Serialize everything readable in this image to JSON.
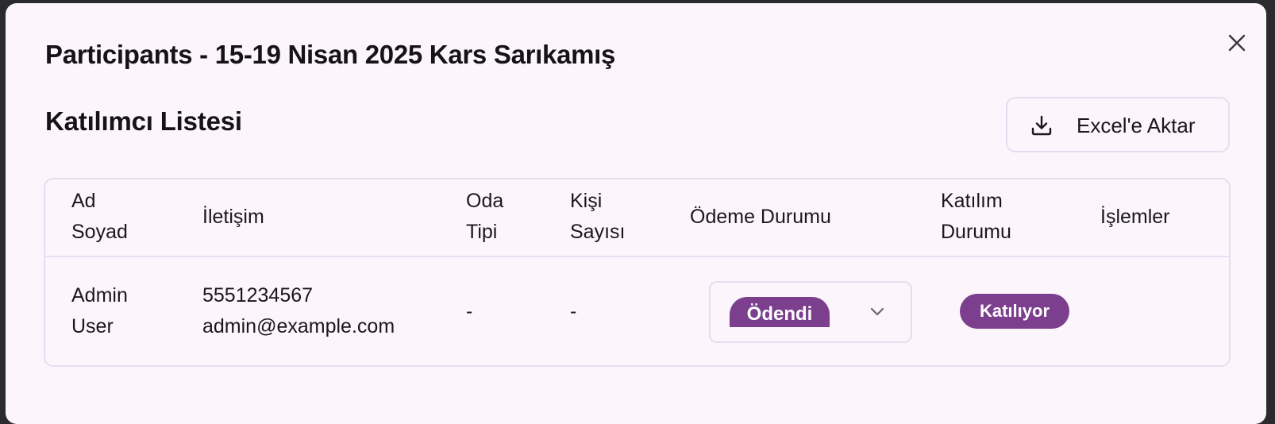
{
  "dialog": {
    "title": "Participants - 15-19 Nisan 2025 Kars Sarıkamış",
    "close_icon": "close-icon"
  },
  "section": {
    "title": "Katılımcı Listesi"
  },
  "export": {
    "label": "Excel'e Aktar",
    "icon": "download-icon"
  },
  "table": {
    "columns": [
      {
        "line1": "Ad",
        "line2": "Soyad"
      },
      {
        "line1": "İletişim",
        "line2": ""
      },
      {
        "line1": "Oda",
        "line2": "Tipi"
      },
      {
        "line1": "Kişi",
        "line2": "Sayısı"
      },
      {
        "line1": "Ödeme Durumu",
        "line2": ""
      },
      {
        "line1": "Katılım",
        "line2": "Durumu"
      },
      {
        "line1": "İşlemler",
        "line2": ""
      }
    ],
    "rows": [
      {
        "first_name": "Admin",
        "last_name": "User",
        "phone": "5551234567",
        "email": "admin@example.com",
        "room_type": "-",
        "person_count": "-",
        "payment_status": "Ödendi",
        "participation_status": "Katılıyor"
      }
    ]
  },
  "colors": {
    "accent": "#7b3f8e",
    "border": "#eadcf0",
    "background": "#fcf6fc",
    "text": "#1b171c"
  }
}
